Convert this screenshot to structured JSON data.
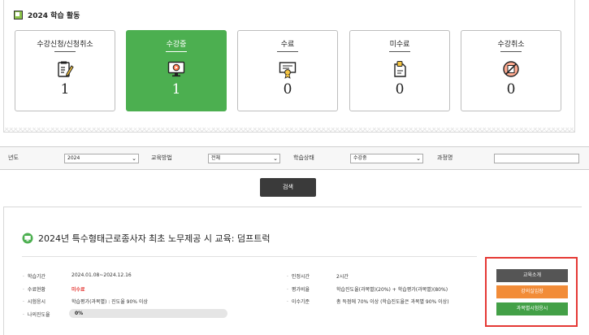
{
  "activity": {
    "title": "2024 학습 활동",
    "cards": [
      {
        "label": "수강신청/신청취소",
        "count": "1",
        "icon": "clipboard-pencil-icon",
        "active": false
      },
      {
        "label": "수강중",
        "count": "1",
        "icon": "video-monitor-icon",
        "active": true
      },
      {
        "label": "수료",
        "count": "0",
        "icon": "certificate-icon",
        "active": false
      },
      {
        "label": "미수료",
        "count": "0",
        "icon": "document-clip-icon",
        "active": false
      },
      {
        "label": "수강취소",
        "count": "0",
        "icon": "cancel-circle-icon",
        "active": false
      }
    ]
  },
  "filters": {
    "year_label": "년도",
    "year_value": "2024",
    "method_label": "교육방법",
    "method_value": "전체",
    "status_label": "학습상태",
    "status_value": "수강중",
    "course_label": "과정명",
    "course_value": ""
  },
  "search_label": "검색",
  "course": {
    "title": "2024년 특수형태근로종사자 최초 노무제공 시 교육: 덤프트럭",
    "period_label": "학습기간",
    "period_value": "2024.01.08~2024.12.16",
    "status_label": "수료현황",
    "status_value": "미수료",
    "exam_label": "시험응시",
    "exam_value": "학습평가(과목별) : 진도율 90% 이상",
    "progress_label": "나의진도율",
    "progress_value": "0%",
    "progress_fraction": 0,
    "hours_label": "인정시간",
    "hours_value": "2시간",
    "eval_label": "평가비율",
    "eval_value": "학습진도율(과목별)(20%) + 학습평가(과목별)(80%)",
    "criteria_label": "이수기준",
    "criteria_value": "총 득점에 70% 이상 (학습진도율은 과목별 90% 이상)"
  },
  "actions": {
    "intro_label": "교육소개",
    "enter_label": "강의실입장",
    "exam_label": "과목별시험응시"
  },
  "colors": {
    "active_card": "#4caf50",
    "intro_button": "#555555",
    "enter_button": "#f28c38",
    "exam_button": "#43a047",
    "highlight_box": "#e53935",
    "status_red": "#e53935"
  }
}
